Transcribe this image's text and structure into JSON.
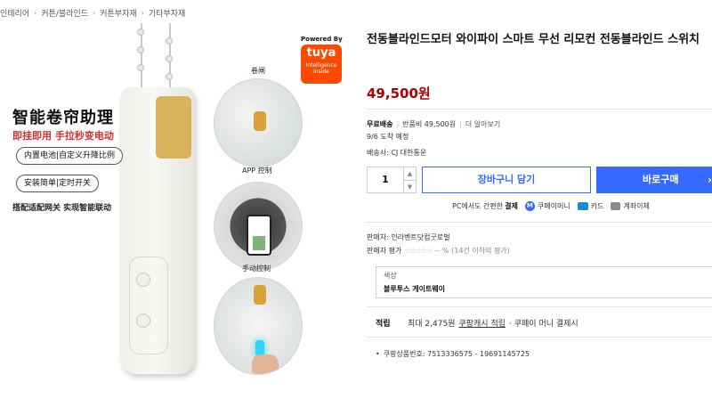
{
  "breadcrumb": [
    "인테리어",
    "커튼/블라인드",
    "커튼부자재",
    "기타부자재"
  ],
  "product_image": {
    "promo_title": "智能卷帘助理",
    "promo_subtitle": "即挂即用 手拉秒变电动",
    "promo_pills": [
      "内置电池|自定义升降比例",
      "安装简单|定时开关"
    ],
    "promo_footer": "搭配适配网关 实现智能联动",
    "tuya_powered": "Powered By",
    "tuya_brand": "tuya",
    "tuya_tagline": "Intelligence inside",
    "circle_labels": [
      "卷闸",
      "APP 控制",
      "手动控制"
    ]
  },
  "product": {
    "title": "전동블라인드모터 와이파이 스마트 무선 리모컨 전동블라인드 스위치",
    "price": "49,500원",
    "free_shipping": "무료배송",
    "return_fee": "반품비 49,500원",
    "see_more": "더 알아보기",
    "eta": "9/6 도착 예정",
    "carrier": "배송사: CJ 대한통운",
    "quantity": "1",
    "cart_button": "장바구니 담기",
    "buy_button": "바로구매",
    "pay_prefix": "PC에서도 간편한",
    "pay_strong": "결제",
    "pay_methods": [
      "쿠페이머니",
      "카드",
      "계좌이체"
    ],
    "seller": "판매자: 인라벤트닷컴굿로벌",
    "seller_rating_label": "판매자 평가",
    "seller_rating_value": "-- %",
    "seller_rating_count": "(14건 이하의 평가)",
    "option_label": "색상",
    "option_value": "블루투스 게이트웨이",
    "reward_label": "적립",
    "reward_prefix": "최대 2,475원",
    "reward_link": "쿠팡캐시 적립",
    "reward_suffix": "· 쿠페이 머니 결제시",
    "product_code": "쿠팡상품번호: 7513336575 - 19691145725"
  },
  "colors": {
    "accent": "#346aff",
    "price": "#ae0000",
    "promo_red": "#d9302b",
    "tuya_orange": "#ff4800"
  }
}
